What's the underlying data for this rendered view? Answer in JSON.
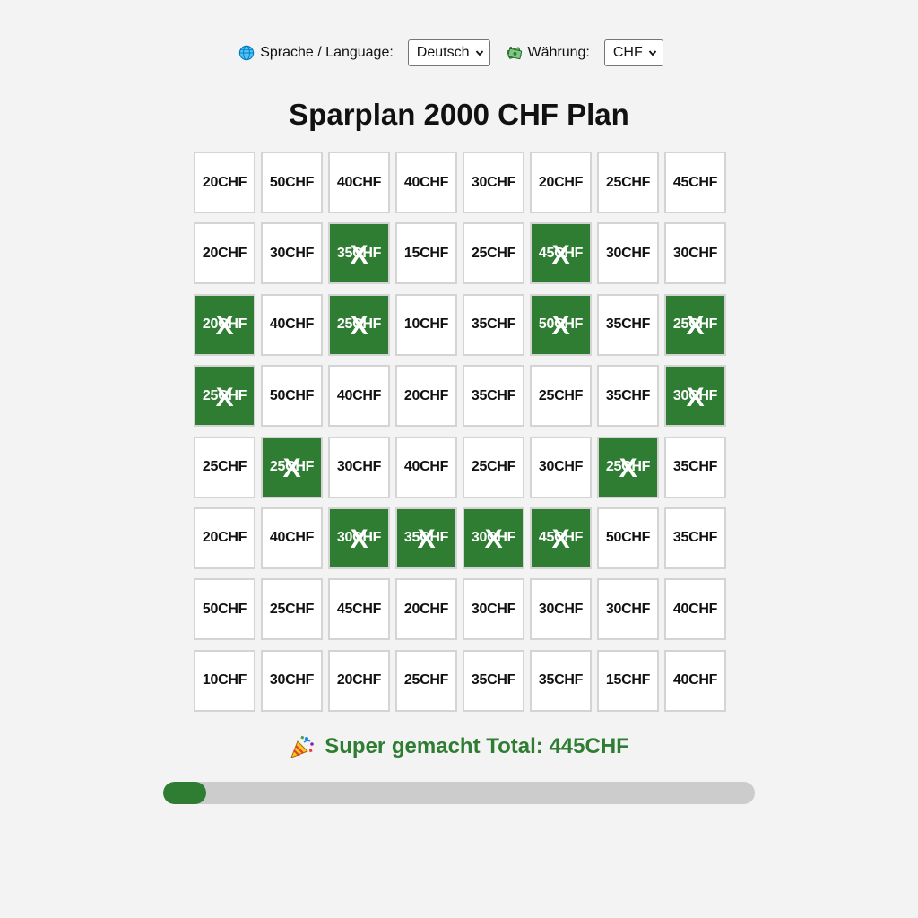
{
  "controls": {
    "language_label": "Sprache / Language:",
    "language_value": "Deutsch",
    "currency_label": "Währung:",
    "currency_value": "CHF"
  },
  "title": "Sparplan 2000 CHF Plan",
  "grid": {
    "mark": "X",
    "cells": [
      {
        "label": "20CHF",
        "done": false
      },
      {
        "label": "50CHF",
        "done": false
      },
      {
        "label": "40CHF",
        "done": false
      },
      {
        "label": "40CHF",
        "done": false
      },
      {
        "label": "30CHF",
        "done": false
      },
      {
        "label": "20CHF",
        "done": false
      },
      {
        "label": "25CHF",
        "done": false
      },
      {
        "label": "45CHF",
        "done": false
      },
      {
        "label": "20CHF",
        "done": false
      },
      {
        "label": "30CHF",
        "done": false
      },
      {
        "label": "35CHF",
        "done": true
      },
      {
        "label": "15CHF",
        "done": false
      },
      {
        "label": "25CHF",
        "done": false
      },
      {
        "label": "45CHF",
        "done": true
      },
      {
        "label": "30CHF",
        "done": false
      },
      {
        "label": "30CHF",
        "done": false
      },
      {
        "label": "20CHF",
        "done": true
      },
      {
        "label": "40CHF",
        "done": false
      },
      {
        "label": "25CHF",
        "done": true
      },
      {
        "label": "10CHF",
        "done": false
      },
      {
        "label": "35CHF",
        "done": false
      },
      {
        "label": "50CHF",
        "done": true
      },
      {
        "label": "35CHF",
        "done": false
      },
      {
        "label": "25CHF",
        "done": true
      },
      {
        "label": "25CHF",
        "done": true
      },
      {
        "label": "50CHF",
        "done": false
      },
      {
        "label": "40CHF",
        "done": false
      },
      {
        "label": "20CHF",
        "done": false
      },
      {
        "label": "35CHF",
        "done": false
      },
      {
        "label": "25CHF",
        "done": false
      },
      {
        "label": "35CHF",
        "done": false
      },
      {
        "label": "30CHF",
        "done": true
      },
      {
        "label": "25CHF",
        "done": false
      },
      {
        "label": "25CHF",
        "done": true
      },
      {
        "label": "30CHF",
        "done": false
      },
      {
        "label": "40CHF",
        "done": false
      },
      {
        "label": "25CHF",
        "done": false
      },
      {
        "label": "30CHF",
        "done": false
      },
      {
        "label": "25CHF",
        "done": true
      },
      {
        "label": "35CHF",
        "done": false
      },
      {
        "label": "20CHF",
        "done": false
      },
      {
        "label": "40CHF",
        "done": false
      },
      {
        "label": "30CHF",
        "done": true
      },
      {
        "label": "35CHF",
        "done": true
      },
      {
        "label": "30CHF",
        "done": true
      },
      {
        "label": "45CHF",
        "done": true
      },
      {
        "label": "50CHF",
        "done": false
      },
      {
        "label": "35CHF",
        "done": false
      },
      {
        "label": "50CHF",
        "done": false
      },
      {
        "label": "25CHF",
        "done": false
      },
      {
        "label": "45CHF",
        "done": false
      },
      {
        "label": "20CHF",
        "done": false
      },
      {
        "label": "30CHF",
        "done": false
      },
      {
        "label": "30CHF",
        "done": false
      },
      {
        "label": "30CHF",
        "done": false
      },
      {
        "label": "40CHF",
        "done": false
      },
      {
        "label": "10CHF",
        "done": false
      },
      {
        "label": "30CHF",
        "done": false
      },
      {
        "label": "20CHF",
        "done": false
      },
      {
        "label": "25CHF",
        "done": false
      },
      {
        "label": "35CHF",
        "done": false
      },
      {
        "label": "35CHF",
        "done": false
      },
      {
        "label": "15CHF",
        "done": false
      },
      {
        "label": "40CHF",
        "done": false
      }
    ]
  },
  "summary": {
    "text": "Super gemacht Total: 445CHF"
  },
  "progress": {
    "fraction": 0.0725
  },
  "colors": {
    "done_green": "#2e7d32",
    "track_gray": "#cccccc",
    "background": "#f3f3f3"
  },
  "icons": {
    "language": "globe-icon",
    "currency": "money-icon",
    "summary": "party-popper-icon",
    "select": "chevron-down-icon"
  }
}
